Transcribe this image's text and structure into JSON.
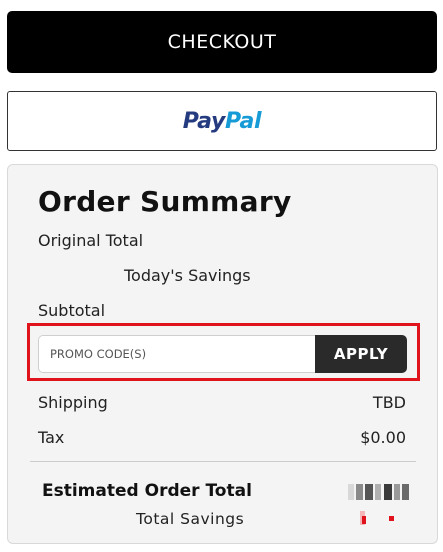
{
  "checkout": {
    "label": "CHECKOUT"
  },
  "paypal": {
    "pay": "Pay",
    "pal": "Pal"
  },
  "summary": {
    "title": "Order Summary",
    "original_total_label": "Original Total",
    "todays_savings_label": "Today's Savings",
    "subtotal_label": "Subtotal",
    "promo": {
      "placeholder": "PROMO CODE(S)",
      "apply_label": "APPLY"
    },
    "shipping_label": "Shipping",
    "shipping_value": "TBD",
    "tax_label": "Tax",
    "tax_value": "$0.00",
    "estimated_total_label": "Estimated Order Total",
    "total_savings_label": "Total Savings"
  },
  "colors": {
    "highlight": "#e0131c",
    "paypal_dark": "#253b80",
    "paypal_light": "#179bd7",
    "savings_redacted": "#e0131c"
  }
}
